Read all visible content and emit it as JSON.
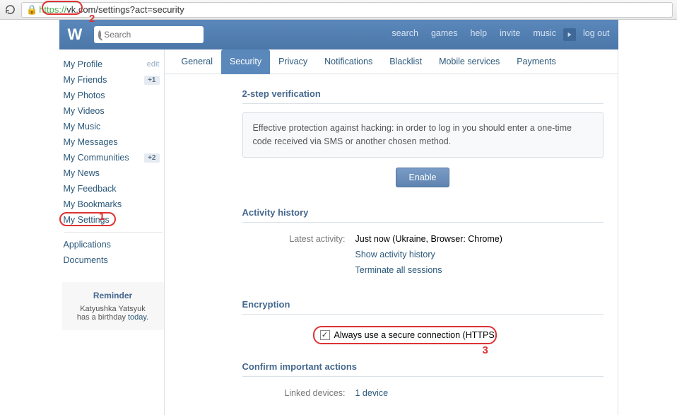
{
  "browser": {
    "url_https": "https://",
    "url_rest": "vk.com/settings?act=security"
  },
  "header": {
    "search_placeholder": "Search",
    "links": [
      "search",
      "games",
      "help",
      "invite",
      "music"
    ],
    "logout": "log out"
  },
  "sidebar": {
    "items": [
      {
        "label": "My Profile",
        "extra": "edit",
        "extra_type": "edit"
      },
      {
        "label": "My Friends",
        "extra": "+1",
        "extra_type": "badge"
      },
      {
        "label": "My Photos"
      },
      {
        "label": "My Videos"
      },
      {
        "label": "My Music"
      },
      {
        "label": "My Messages"
      },
      {
        "label": "My Communities",
        "extra": "+2",
        "extra_type": "badge"
      },
      {
        "label": "My News"
      },
      {
        "label": "My Feedback"
      },
      {
        "label": "My Bookmarks"
      },
      {
        "label": "My Settings",
        "annotated": true
      }
    ],
    "secondary": [
      {
        "label": "Applications"
      },
      {
        "label": "Documents"
      }
    ]
  },
  "reminder": {
    "title": "Reminder",
    "name": "Katyushka Yatsyuk",
    "text_prefix": "has a birthday ",
    "link": "today",
    "suffix": "."
  },
  "tabs": [
    "General",
    "Security",
    "Privacy",
    "Notifications",
    "Blacklist",
    "Mobile services",
    "Payments"
  ],
  "active_tab": "Security",
  "sections": {
    "two_step": {
      "title": "2-step verification",
      "body": "Effective protection against hacking: in order to log in you should enter a one-time code received via SMS or another chosen method.",
      "button": "Enable"
    },
    "activity": {
      "title": "Activity history",
      "latest_label": "Latest activity:",
      "latest_value": "Just now (Ukraine, Browser: Chrome)",
      "show_history": "Show activity history",
      "terminate": "Terminate all sessions"
    },
    "encryption": {
      "title": "Encryption",
      "checkbox_label": "Always use a secure connection (HTTPS)"
    },
    "confirm": {
      "title": "Confirm important actions",
      "linked_label": "Linked devices:",
      "linked_value": "1 device"
    }
  },
  "annotations": {
    "n1": "1",
    "n2": "2",
    "n3": "3"
  }
}
